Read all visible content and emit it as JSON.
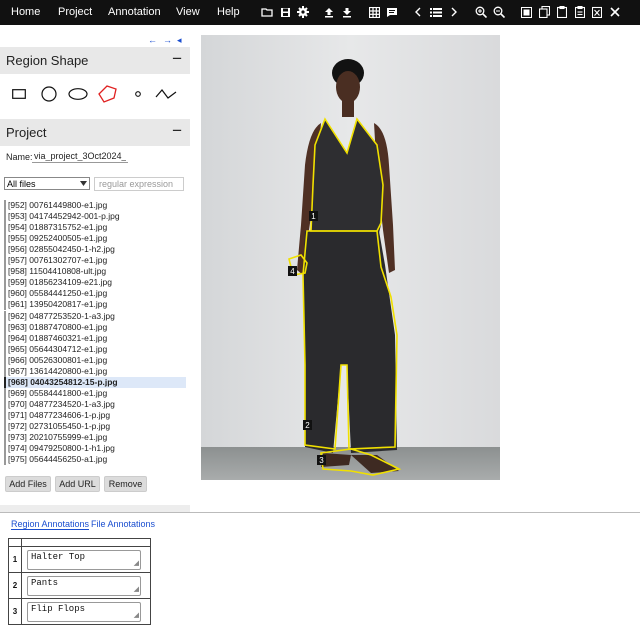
{
  "menu": {
    "items": [
      "Home",
      "Project",
      "Annotation",
      "View",
      "Help"
    ]
  },
  "toolbar": {
    "icons": [
      "folder-open-icon",
      "save-icon",
      "gear-icon",
      "upload-icon",
      "download-icon",
      "grid-view-icon",
      "comment-icon",
      "prev-icon",
      "list-icon",
      "next-icon",
      "zoom-in-icon",
      "zoom-out-icon",
      "select-all-icon",
      "copy-icon",
      "paste-icon",
      "clipboard-icon",
      "delete-icon",
      "close-icon"
    ]
  },
  "panel_toggle": {
    "left": "←",
    "right": "→",
    "collapse": "◂"
  },
  "region_shape": {
    "title": "Region Shape",
    "collapse": "−",
    "shapes": [
      "rectangle",
      "circle",
      "ellipse",
      "polygon",
      "point",
      "polyline"
    ],
    "selected": "polygon"
  },
  "project": {
    "title": "Project",
    "collapse": "−",
    "name_label": "Name:",
    "name_value": "via_project_3Oct2024_",
    "filter_selected": "All files",
    "regex_placeholder": "regular expression",
    "files": [
      "[952] 00761449800-e1.jpg",
      "[953] 04174452942-001-p.jpg",
      "[954] 01887315752-e1.jpg",
      "[955] 09252400505-e1.jpg",
      "[956] 02855042450-1-h2.jpg",
      "[957] 00761302707-e1.jpg",
      "[958] 11504410808-ult.jpg",
      "[959] 01856234109-e21.jpg",
      "[960] 05584441250-e1.jpg",
      "[961] 13950420817-e1.jpg",
      "[962] 04877253520-1-a3.jpg",
      "[963] 01887470800-e1.jpg",
      "[964] 01887460321-e1.jpg",
      "[965] 05644304712-e1.jpg",
      "[966] 00526300801-e1.jpg",
      "[967] 13614420800-e1.jpg",
      "[968] 04043254812-15-p.jpg",
      "[969] 05584441800-e1.jpg",
      "[970] 04877234520-1-a3.jpg",
      "[971] 04877234606-1-p.jpg",
      "[972] 02731055450-1-p.jpg",
      "[973] 20210755999-e1.jpg",
      "[974] 09479250800-1-h1.jpg",
      "[975] 05644456250-a1.jpg"
    ],
    "selected_index": 16,
    "buttons": {
      "add_files": "Add Files",
      "add_url": "Add URL",
      "remove": "Remove"
    }
  },
  "image": {
    "regions": [
      {
        "id": "1",
        "label": "Halter Top"
      },
      {
        "id": "2",
        "label": "Pants"
      },
      {
        "id": "3",
        "label": "Flip Flops"
      },
      {
        "id": "4",
        "label": ""
      }
    ],
    "region_color": "#f0e000",
    "description": "woman in dark halter jumpsuit against grey wall"
  },
  "annotations": {
    "tabs": [
      "Region Annotations",
      "File Annotations"
    ],
    "active_tab": 0,
    "rows": [
      {
        "num": "1",
        "value": "Halter Top"
      },
      {
        "num": "2",
        "value": "Pants"
      },
      {
        "num": "3",
        "value": "Flip Flops"
      }
    ]
  },
  "colors": {
    "topbar": "#111111",
    "accent": "#1a4ed0",
    "polygon_selected": "#e02020"
  }
}
